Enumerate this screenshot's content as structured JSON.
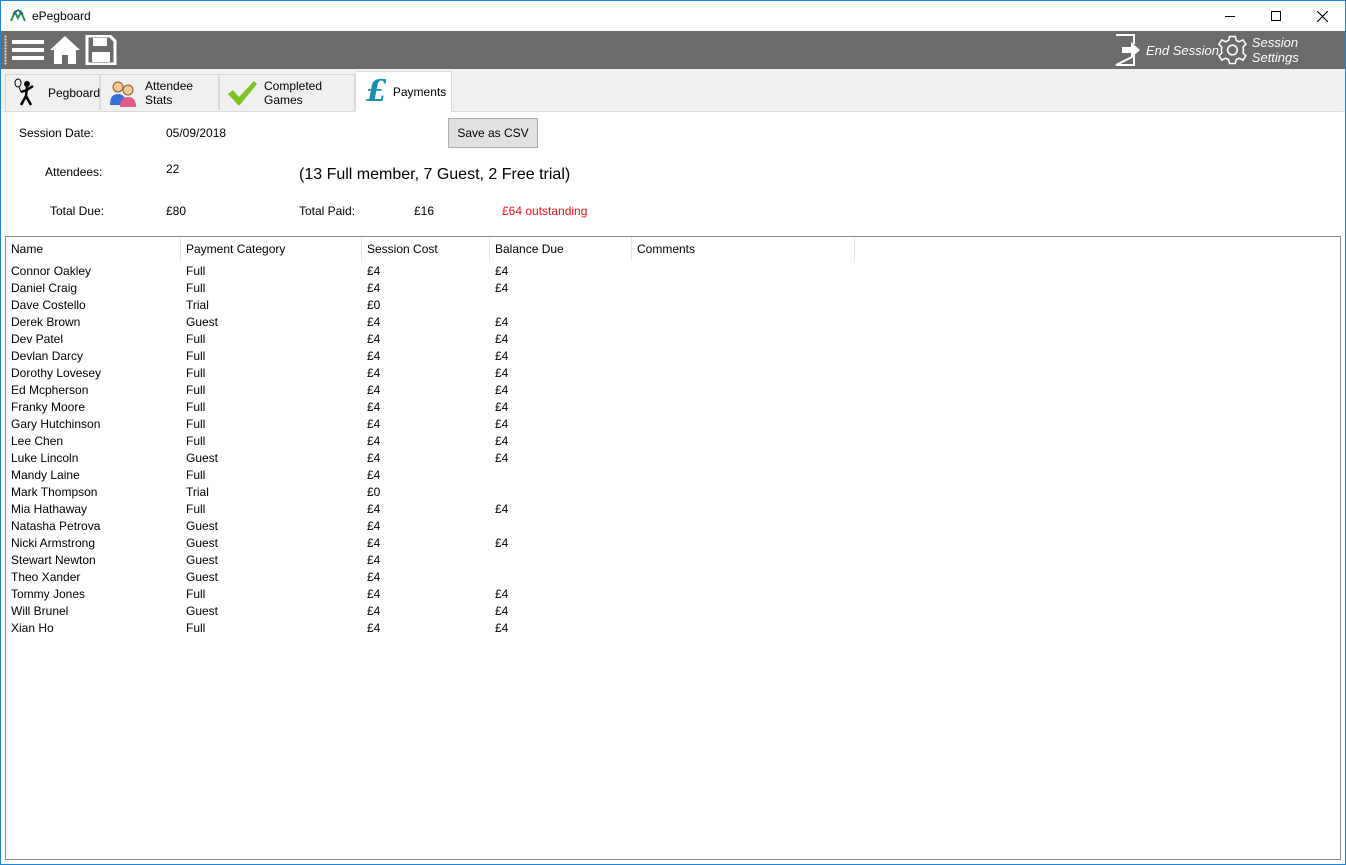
{
  "window": {
    "title": "ePegboard",
    "controls": {
      "minimize": "minimize-icon",
      "maximize": "maximize-icon",
      "close": "close-icon"
    }
  },
  "toolbar": {
    "icons": [
      "menu-icon",
      "home-icon",
      "save-icon"
    ],
    "end_session_label": "End Session",
    "session_settings_label": "Session Settings",
    "background": "#6b6b6b"
  },
  "tabs": [
    {
      "label": "Pegboard",
      "icon": "badminton-player-icon"
    },
    {
      "label": "Attendee Stats",
      "icon": "people-icon"
    },
    {
      "label": "Completed Games",
      "icon": "checkmark-icon"
    },
    {
      "label": "Payments",
      "icon": "pound-icon",
      "active": true
    }
  ],
  "summary": {
    "session_date_label": "Session Date:",
    "session_date_value": "05/09/2018",
    "attendees_label": "Attendees:",
    "attendees_value": "22",
    "breakdown": "(13 Full member, 7 Guest, 2 Free trial)",
    "total_due_label": "Total Due:",
    "total_due_value": "£80",
    "total_paid_label": "Total Paid:",
    "total_paid_value": "£16",
    "outstanding": "£64 outstanding",
    "outstanding_color": "#e8141c",
    "save_csv_label": "Save as CSV"
  },
  "table": {
    "columns": [
      "Name",
      "Payment Category",
      "Session Cost",
      "Balance Due",
      "Comments"
    ],
    "rows": [
      [
        "Connor Oakley",
        "Full",
        "£4",
        "£4",
        ""
      ],
      [
        "Daniel Craig",
        "Full",
        "£4",
        "£4",
        ""
      ],
      [
        "Dave Costello",
        "Trial",
        "£0",
        "",
        ""
      ],
      [
        "Derek Brown",
        "Guest",
        "£4",
        "£4",
        ""
      ],
      [
        "Dev Patel",
        "Full",
        "£4",
        "£4",
        ""
      ],
      [
        "Devlan Darcy",
        "Full",
        "£4",
        "£4",
        ""
      ],
      [
        "Dorothy Lovesey",
        "Full",
        "£4",
        "£4",
        ""
      ],
      [
        "Ed Mcpherson",
        "Full",
        "£4",
        "£4",
        ""
      ],
      [
        "Franky Moore",
        "Full",
        "£4",
        "£4",
        ""
      ],
      [
        "Gary Hutchinson",
        "Full",
        "£4",
        "£4",
        ""
      ],
      [
        "Lee Chen",
        "Full",
        "£4",
        "£4",
        ""
      ],
      [
        "Luke Lincoln",
        "Guest",
        "£4",
        "£4",
        ""
      ],
      [
        "Mandy Laine",
        "Full",
        "£4",
        "",
        ""
      ],
      [
        "Mark Thompson",
        "Trial",
        "£0",
        "",
        ""
      ],
      [
        "Mia Hathaway",
        "Full",
        "£4",
        "£4",
        ""
      ],
      [
        "Natasha Petrova",
        "Guest",
        "£4",
        "",
        ""
      ],
      [
        "Nicki Armstrong",
        "Guest",
        "£4",
        "£4",
        ""
      ],
      [
        "Stewart Newton",
        "Guest",
        "£4",
        "",
        ""
      ],
      [
        "Theo Xander",
        "Guest",
        "£4",
        "",
        ""
      ],
      [
        "Tommy Jones",
        "Full",
        "£4",
        "£4",
        ""
      ],
      [
        "Will Brunel",
        "Guest",
        "£4",
        "£4",
        ""
      ],
      [
        "Xian Ho",
        "Full",
        "£4",
        "£4",
        ""
      ]
    ]
  }
}
